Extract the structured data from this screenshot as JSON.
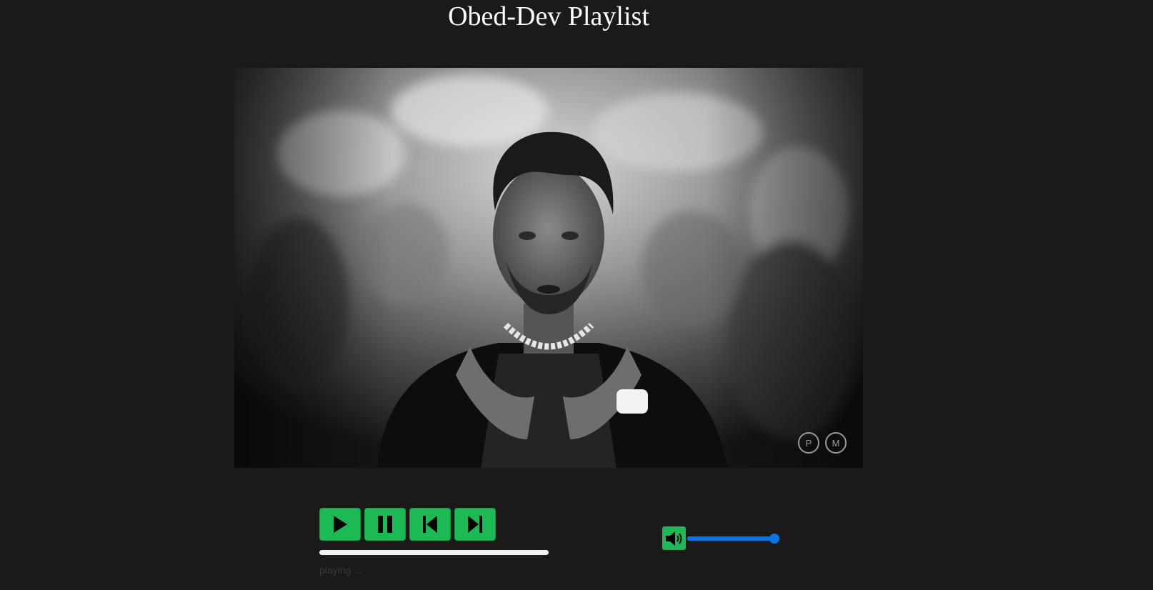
{
  "page": {
    "title": "Obed-Dev Playlist"
  },
  "video": {
    "description_icon": "music-video-still",
    "watermark_letters": [
      "P",
      "M"
    ]
  },
  "controls": {
    "buttons": [
      {
        "name": "play",
        "icon": "play-icon"
      },
      {
        "name": "pause",
        "icon": "pause-icon"
      },
      {
        "name": "previous",
        "icon": "skip-back-icon"
      },
      {
        "name": "next",
        "icon": "skip-forward-icon"
      }
    ]
  },
  "status": {
    "text": "playing ..."
  },
  "volume": {
    "icon": "speaker-icon",
    "level": 1.0
  },
  "colors": {
    "background": "#1a1a1a",
    "button": "#1db954",
    "volume_accent": "#0b74e5",
    "progress_track": "#f1f1f1"
  }
}
